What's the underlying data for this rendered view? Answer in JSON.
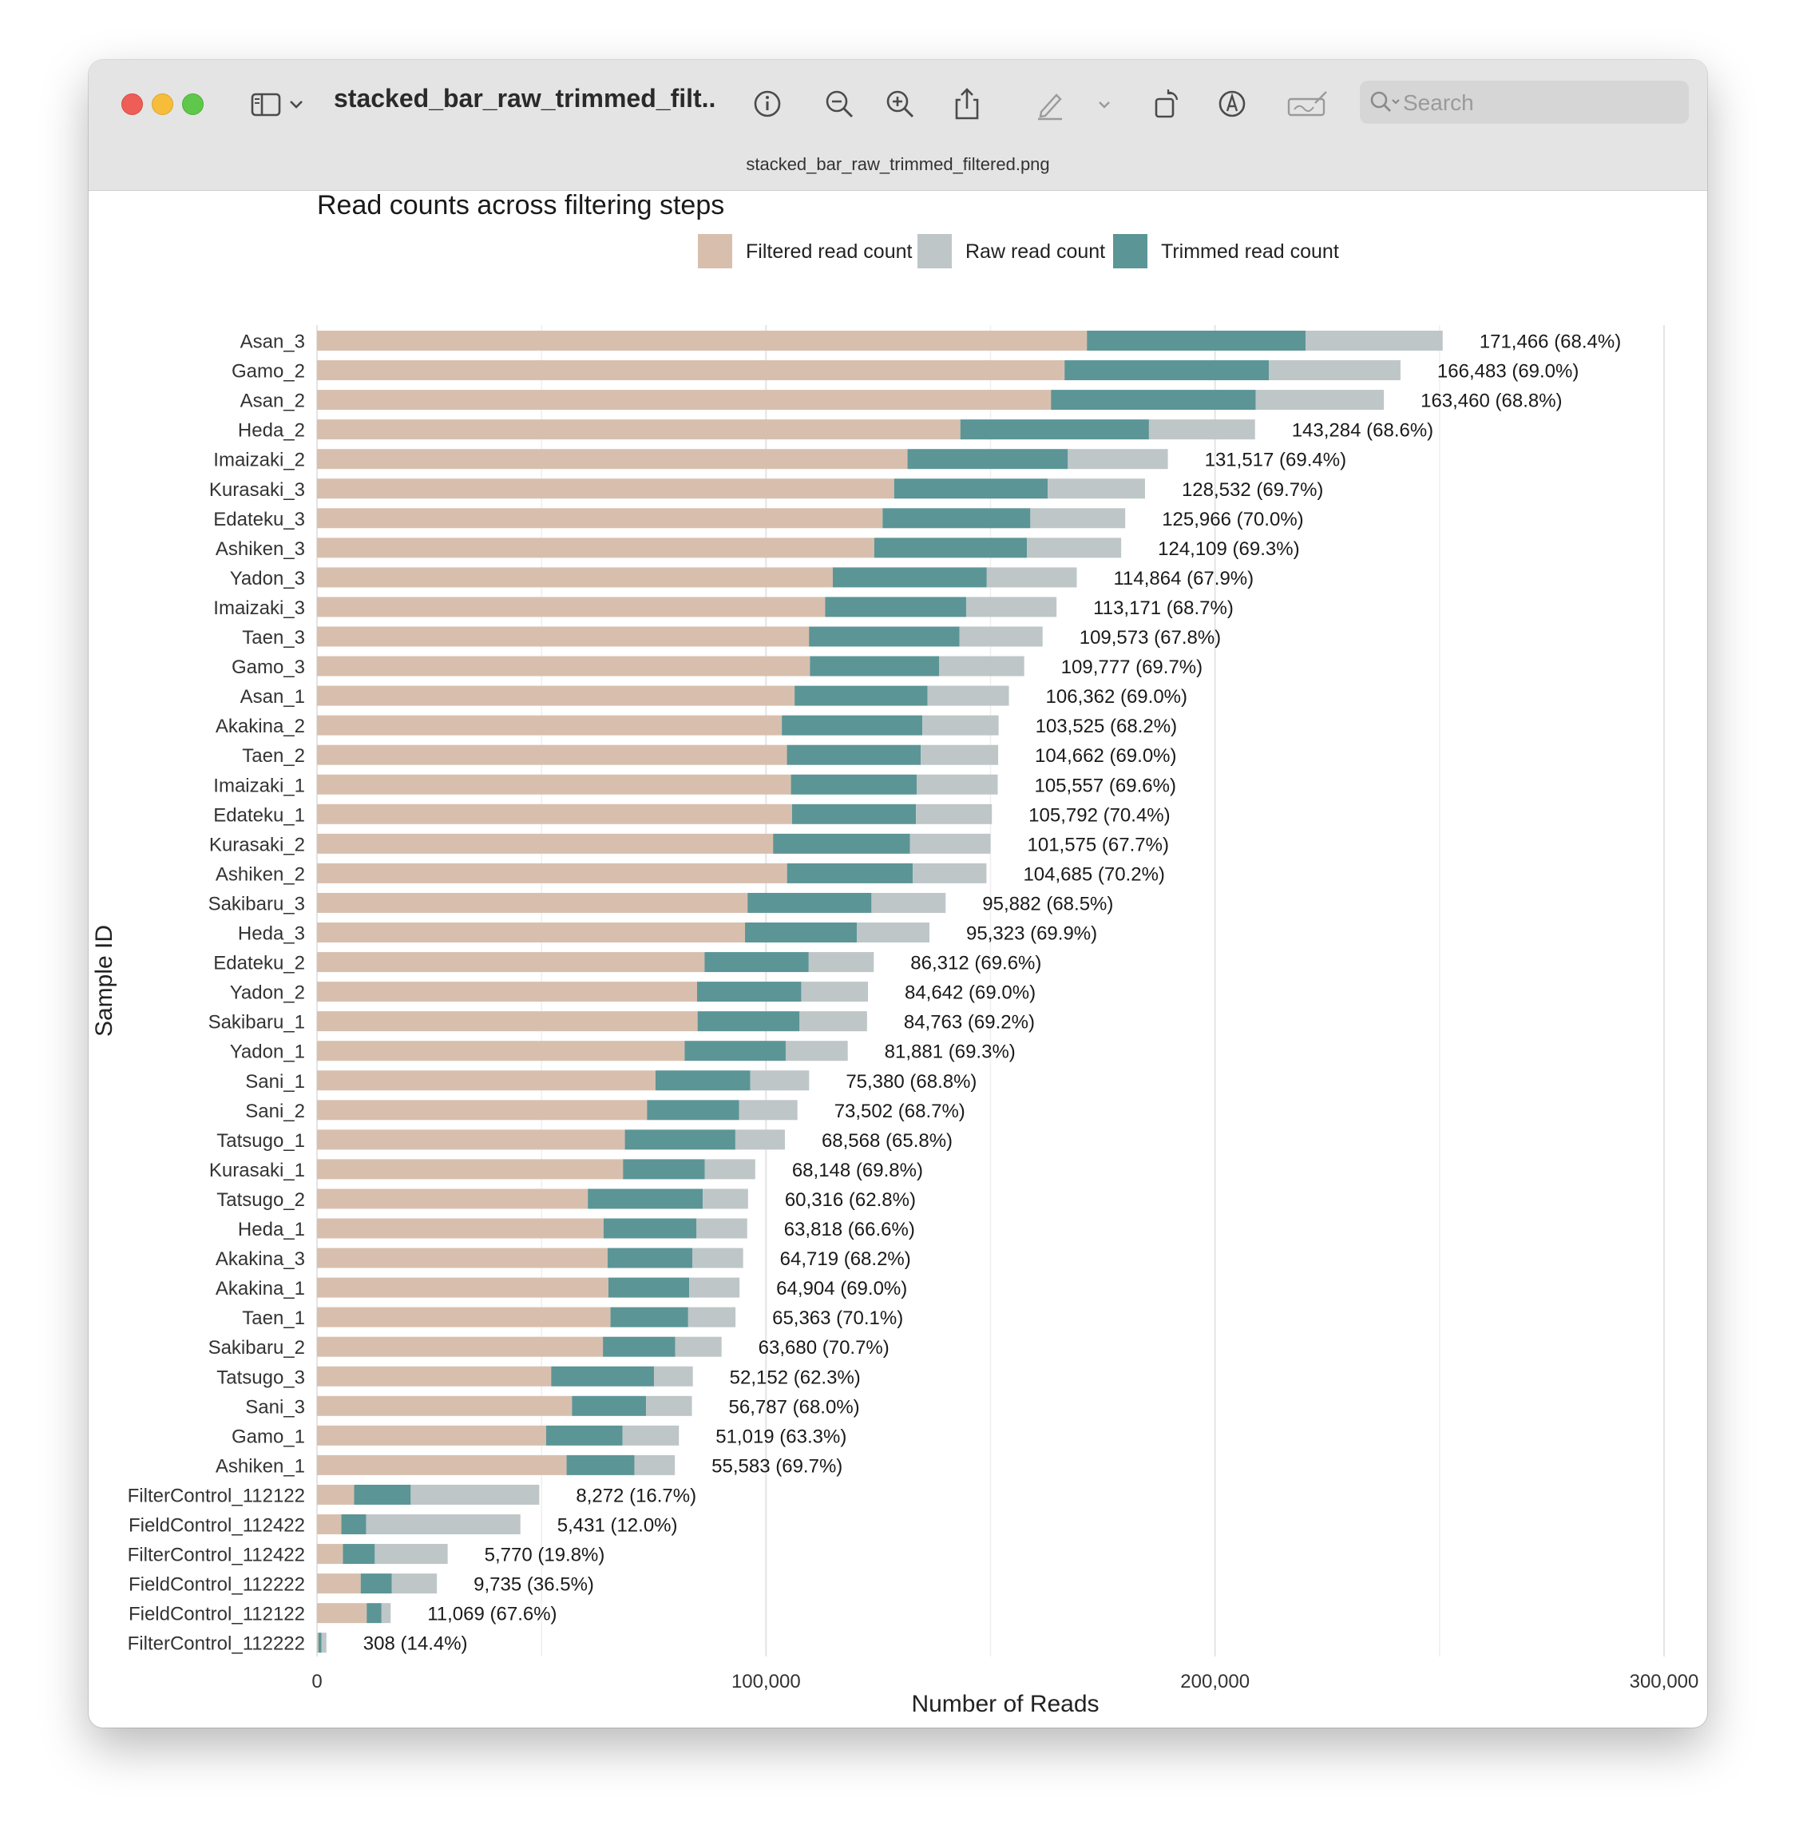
{
  "window": {
    "title": "stacked_bar_raw_trimmed_filt...",
    "filename": "stacked_bar_raw_trimmed_filtered.png",
    "search": {
      "placeholder": "Search"
    }
  },
  "toolbar_icons": [
    "sidebar-icon",
    "chevron-down-icon",
    "info-icon",
    "zoom-out-icon",
    "zoom-in-icon",
    "share-icon",
    "markup-pen-icon",
    "chevron-down-icon",
    "rotate-icon",
    "markup-icon",
    "signature-icon",
    "search-icon"
  ],
  "chart_data": {
    "type": "bar",
    "orientation": "horizontal",
    "stacked": true,
    "title": "Read counts across filtering steps",
    "xlabel": "Number of Reads",
    "ylabel": "Sample ID",
    "xlim": [
      0,
      300000
    ],
    "xticks": [
      0,
      100000,
      200000,
      300000
    ],
    "xtick_labels": [
      "0",
      "100,000",
      "200,000",
      "300,000"
    ],
    "grid": "vertical",
    "legend_position": "top",
    "series": [
      {
        "name": "Filtered read count",
        "color": "#d8bfad"
      },
      {
        "name": "Raw read count",
        "color": "#bec6c8"
      },
      {
        "name": "Trimmed read count",
        "color": "#5c9596"
      }
    ],
    "rows": [
      {
        "sample": "Asan_3",
        "filtered": 171466,
        "trimmed": 48700,
        "raw": 250700,
        "label": "171,466 (68.4%)"
      },
      {
        "sample": "Gamo_2",
        "filtered": 166483,
        "trimmed": 45500,
        "raw": 241300,
        "label": "166,483 (69.0%)"
      },
      {
        "sample": "Asan_2",
        "filtered": 163460,
        "trimmed": 45600,
        "raw": 237600,
        "label": "163,460 (68.8%)"
      },
      {
        "sample": "Heda_2",
        "filtered": 143284,
        "trimmed": 42000,
        "raw": 208900,
        "label": "143,284 (68.6%)"
      },
      {
        "sample": "Imaizaki_2",
        "filtered": 131517,
        "trimmed": 35700,
        "raw": 189500,
        "label": "131,517 (69.4%)"
      },
      {
        "sample": "Kurasaki_3",
        "filtered": 128532,
        "trimmed": 34200,
        "raw": 184400,
        "label": "128,532 (69.7%)"
      },
      {
        "sample": "Edateku_3",
        "filtered": 125966,
        "trimmed": 32900,
        "raw": 180000,
        "label": "125,966 (70.0%)"
      },
      {
        "sample": "Ashiken_3",
        "filtered": 124109,
        "trimmed": 34000,
        "raw": 179100,
        "label": "124,109 (69.3%)"
      },
      {
        "sample": "Yadon_3",
        "filtered": 114864,
        "trimmed": 34300,
        "raw": 169200,
        "label": "114,864 (67.9%)"
      },
      {
        "sample": "Imaizaki_3",
        "filtered": 113171,
        "trimmed": 31400,
        "raw": 164700,
        "label": "113,171 (68.7%)"
      },
      {
        "sample": "Taen_3",
        "filtered": 109573,
        "trimmed": 33500,
        "raw": 161600,
        "label": "109,573 (67.8%)"
      },
      {
        "sample": "Gamo_3",
        "filtered": 109777,
        "trimmed": 28800,
        "raw": 157500,
        "label": "109,777 (69.7%)"
      },
      {
        "sample": "Asan_1",
        "filtered": 106362,
        "trimmed": 29600,
        "raw": 154100,
        "label": "106,362 (69.0%)"
      },
      {
        "sample": "Akakina_2",
        "filtered": 103525,
        "trimmed": 31300,
        "raw": 151800,
        "label": "103,525 (68.2%)"
      },
      {
        "sample": "Taen_2",
        "filtered": 104662,
        "trimmed": 29800,
        "raw": 151700,
        "label": "104,662 (69.0%)"
      },
      {
        "sample": "Imaizaki_1",
        "filtered": 105557,
        "trimmed": 28000,
        "raw": 151600,
        "label": "105,557 (69.6%)"
      },
      {
        "sample": "Edateku_1",
        "filtered": 105792,
        "trimmed": 27600,
        "raw": 150300,
        "label": "105,792 (70.4%)"
      },
      {
        "sample": "Kurasaki_2",
        "filtered": 101575,
        "trimmed": 30500,
        "raw": 150000,
        "label": "101,575 (67.7%)"
      },
      {
        "sample": "Ashiken_2",
        "filtered": 104685,
        "trimmed": 28000,
        "raw": 149100,
        "label": "104,685 (70.2%)"
      },
      {
        "sample": "Sakibaru_3",
        "filtered": 95882,
        "trimmed": 27600,
        "raw": 140000,
        "label": "95,882 (68.5%)"
      },
      {
        "sample": "Heda_3",
        "filtered": 95323,
        "trimmed": 24900,
        "raw": 136400,
        "label": "95,323 (69.9%)"
      },
      {
        "sample": "Edateku_2",
        "filtered": 86312,
        "trimmed": 23200,
        "raw": 124000,
        "label": "86,312 (69.6%)"
      },
      {
        "sample": "Yadon_2",
        "filtered": 84642,
        "trimmed": 23200,
        "raw": 122700,
        "label": "84,642 (69.0%)"
      },
      {
        "sample": "Sakibaru_1",
        "filtered": 84763,
        "trimmed": 22700,
        "raw": 122500,
        "label": "84,763 (69.2%)"
      },
      {
        "sample": "Yadon_1",
        "filtered": 81881,
        "trimmed": 22500,
        "raw": 118200,
        "label": "81,881 (69.3%)"
      },
      {
        "sample": "Sani_1",
        "filtered": 75380,
        "trimmed": 21100,
        "raw": 109600,
        "label": "75,380 (68.8%)"
      },
      {
        "sample": "Sani_2",
        "filtered": 73502,
        "trimmed": 20500,
        "raw": 107000,
        "label": "73,502 (68.7%)"
      },
      {
        "sample": "Tatsugo_1",
        "filtered": 68568,
        "trimmed": 24600,
        "raw": 104200,
        "label": "68,568 (65.8%)"
      },
      {
        "sample": "Kurasaki_1",
        "filtered": 68148,
        "trimmed": 18200,
        "raw": 97600,
        "label": "68,148 (69.8%)"
      },
      {
        "sample": "Tatsugo_2",
        "filtered": 60316,
        "trimmed": 25600,
        "raw": 96000,
        "label": "60,316 (62.8%)"
      },
      {
        "sample": "Heda_1",
        "filtered": 63818,
        "trimmed": 20700,
        "raw": 95800,
        "label": "63,818 (66.6%)"
      },
      {
        "sample": "Akakina_3",
        "filtered": 64719,
        "trimmed": 18900,
        "raw": 94900,
        "label": "64,719 (68.2%)"
      },
      {
        "sample": "Akakina_1",
        "filtered": 64904,
        "trimmed": 18000,
        "raw": 94100,
        "label": "64,904 (69.0%)"
      },
      {
        "sample": "Taen_1",
        "filtered": 65363,
        "trimmed": 17300,
        "raw": 93200,
        "label": "65,363 (70.1%)"
      },
      {
        "sample": "Sakibaru_2",
        "filtered": 63680,
        "trimmed": 16100,
        "raw": 90100,
        "label": "63,680 (70.7%)"
      },
      {
        "sample": "Tatsugo_3",
        "filtered": 52152,
        "trimmed": 22900,
        "raw": 83700,
        "label": "52,152 (62.3%)"
      },
      {
        "sample": "Sani_3",
        "filtered": 56787,
        "trimmed": 16500,
        "raw": 83500,
        "label": "56,787 (68.0%)"
      },
      {
        "sample": "Gamo_1",
        "filtered": 51019,
        "trimmed": 17000,
        "raw": 80600,
        "label": "51,019 (63.3%)"
      },
      {
        "sample": "Ashiken_1",
        "filtered": 55583,
        "trimmed": 15100,
        "raw": 79700,
        "label": "55,583 (69.7%)"
      },
      {
        "sample": "FilterControl_112122",
        "filtered": 8272,
        "trimmed": 12600,
        "raw": 49500,
        "label": "8,272 (16.7%)"
      },
      {
        "sample": "FieldControl_112422",
        "filtered": 5431,
        "trimmed": 5500,
        "raw": 45300,
        "label": "5,431 (12.0%)"
      },
      {
        "sample": "FilterControl_112422",
        "filtered": 5770,
        "trimmed": 7100,
        "raw": 29100,
        "label": "5,770 (19.8%)"
      },
      {
        "sample": "FieldControl_112222",
        "filtered": 9735,
        "trimmed": 6900,
        "raw": 26700,
        "label": "9,735 (36.5%)"
      },
      {
        "sample": "FieldControl_112122",
        "filtered": 11069,
        "trimmed": 3300,
        "raw": 16400,
        "label": "11,069 (67.6%)"
      },
      {
        "sample": "FilterControl_112222",
        "filtered": 308,
        "trimmed": 700,
        "raw": 2100,
        "label": "308 (14.4%)"
      }
    ]
  }
}
